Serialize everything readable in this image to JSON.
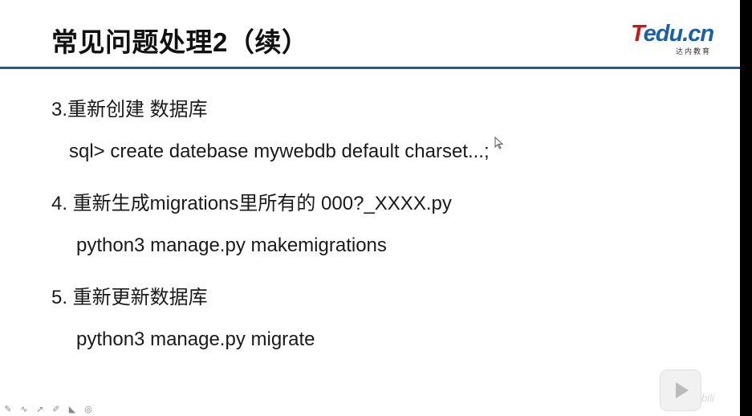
{
  "slide": {
    "title": "常见问题处理2（续）",
    "logo": {
      "main_t": "T",
      "main_rest": "edu.cn",
      "sub": "达内教育"
    },
    "lines": [
      "3.重新创建 数据库",
      "sql> create datebase mywebdb default charset...;",
      "4. 重新生成migrations里所有的 000?_XXXX.py",
      "python3 manage.py makemigrations",
      "5. 重新更新数据库",
      "python3 manage.py migrate"
    ]
  },
  "player": {
    "watermark": "bili"
  },
  "icons": [
    "pen-icon",
    "curve-icon",
    "arrow-icon",
    "pointer-icon",
    "eraser-icon",
    "locate-icon"
  ],
  "colors": {
    "title_rule": "#1f5f8f",
    "logo_red": "#c8161d",
    "logo_blue": "#1b5fa8"
  }
}
